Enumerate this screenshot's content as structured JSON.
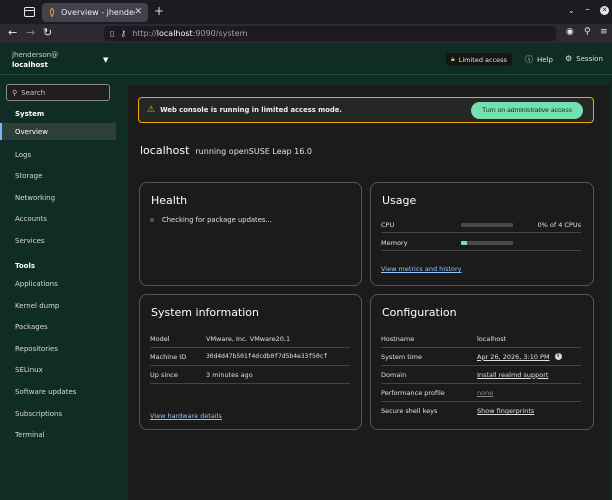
{
  "browser": {
    "tab_title": "Overview - jhenderson@",
    "new_tab_symbol": "+",
    "url_host": "localhost",
    "url_rest": ":9090/system",
    "url_prefix": "http://"
  },
  "header": {
    "user": "jhenderson@",
    "host": "localhost",
    "limited_access": "Limited access",
    "help": "Help",
    "session": "Session"
  },
  "sidebar": {
    "search_placeholder": "Search",
    "sections": [
      {
        "title": "System",
        "items": [
          "Overview",
          "Logs",
          "Storage",
          "Networking",
          "Accounts",
          "Services"
        ]
      },
      {
        "title": "Tools",
        "items": [
          "Applications",
          "Kernel dump",
          "Packages",
          "Repositories",
          "SELinux",
          "Software updates",
          "Subscriptions",
          "Terminal"
        ]
      }
    ],
    "active_item": "Overview"
  },
  "alert": {
    "message": "Web console is running in limited access mode.",
    "button": "Turn on administrative access"
  },
  "page": {
    "hostname": "localhost",
    "os": "running openSUSE Leap 16.0"
  },
  "health": {
    "title": "Health",
    "status": "Checking for package updates..."
  },
  "usage": {
    "title": "Usage",
    "cpu_label": "CPU",
    "cpu_value": "0% of 4 CPUs",
    "cpu_fraction": 0.0,
    "memory_label": "Memory",
    "memory_fraction": 0.12,
    "link": "View metrics and history"
  },
  "system_info": {
    "title": "System information",
    "rows": [
      {
        "key": "Model",
        "value": "VMware, Inc. VMware20,1"
      },
      {
        "key": "Machine ID",
        "value": "30d4d47b501f4dcdb0f7d5b4e33f50cf"
      },
      {
        "key": "Up since",
        "value": "3 minutes ago"
      }
    ],
    "link": "View hardware details"
  },
  "configuration": {
    "title": "Configuration",
    "rows": [
      {
        "key": "Hostname",
        "value": "localhost"
      },
      {
        "key": "System time",
        "value": "Apr 26, 2026, 3:10 PM"
      },
      {
        "key": "Domain",
        "value": "Install realmd support"
      },
      {
        "key": "Performance profile",
        "value": "none"
      },
      {
        "key": "Secure shell keys",
        "value": "Show fingerprints"
      }
    ]
  },
  "colors": {
    "accent": "#73e0b0",
    "header_bg": "#0f2d25",
    "warning": "#f0ab00",
    "link": "#92c5f9"
  }
}
